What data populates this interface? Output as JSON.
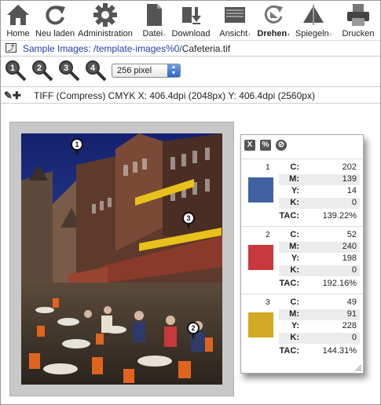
{
  "toolbar": {
    "items": [
      {
        "label": "Home",
        "icon": "home-icon"
      },
      {
        "label": "Neu laden",
        "icon": "reload-icon"
      },
      {
        "label": "Administration",
        "icon": "gear-icon"
      },
      {
        "label": "Datei",
        "icon": "file-icon",
        "menu": "›"
      },
      {
        "label": "Download",
        "icon": "download-icon"
      },
      {
        "label": "Ansicht",
        "icon": "view-icon",
        "menu": "›"
      },
      {
        "label": "Drehen",
        "icon": "rotate-icon",
        "menu": "›"
      },
      {
        "label": "Spiegeln",
        "icon": "mirror-icon",
        "menu": "›"
      },
      {
        "label": "Drucken",
        "icon": "print-icon"
      }
    ]
  },
  "path": {
    "prefix": "Sample Images: /template-images%0/",
    "file": "Cafeteria.tif"
  },
  "zoom": {
    "levels": [
      "1",
      "2",
      "3",
      "4"
    ],
    "select_value": "256 pixel"
  },
  "info": {
    "text": "TIFF (Compress)  CMYK   X: 406.4dpi (2048px)  Y: 406.4dpi (2560px)"
  },
  "pins": [
    "1",
    "2",
    "3"
  ],
  "panel": {
    "tools": [
      "X",
      "%",
      "⊘"
    ],
    "entries": [
      {
        "num": "1",
        "color": "#3f62a3",
        "C": "202",
        "M": "139",
        "Y": "14",
        "K": "0",
        "TAC": "139.22%"
      },
      {
        "num": "2",
        "color": "#c8383c",
        "C": "52",
        "M": "240",
        "Y": "198",
        "K": "0",
        "TAC": "192.16%"
      },
      {
        "num": "3",
        "color": "#d3a823",
        "C": "49",
        "M": "91",
        "Y": "228",
        "K": "0",
        "TAC": "144.31%"
      }
    ],
    "labels": {
      "C": "C:",
      "M": "M:",
      "Y": "Y:",
      "K": "K:",
      "TAC": "TAC:"
    }
  }
}
